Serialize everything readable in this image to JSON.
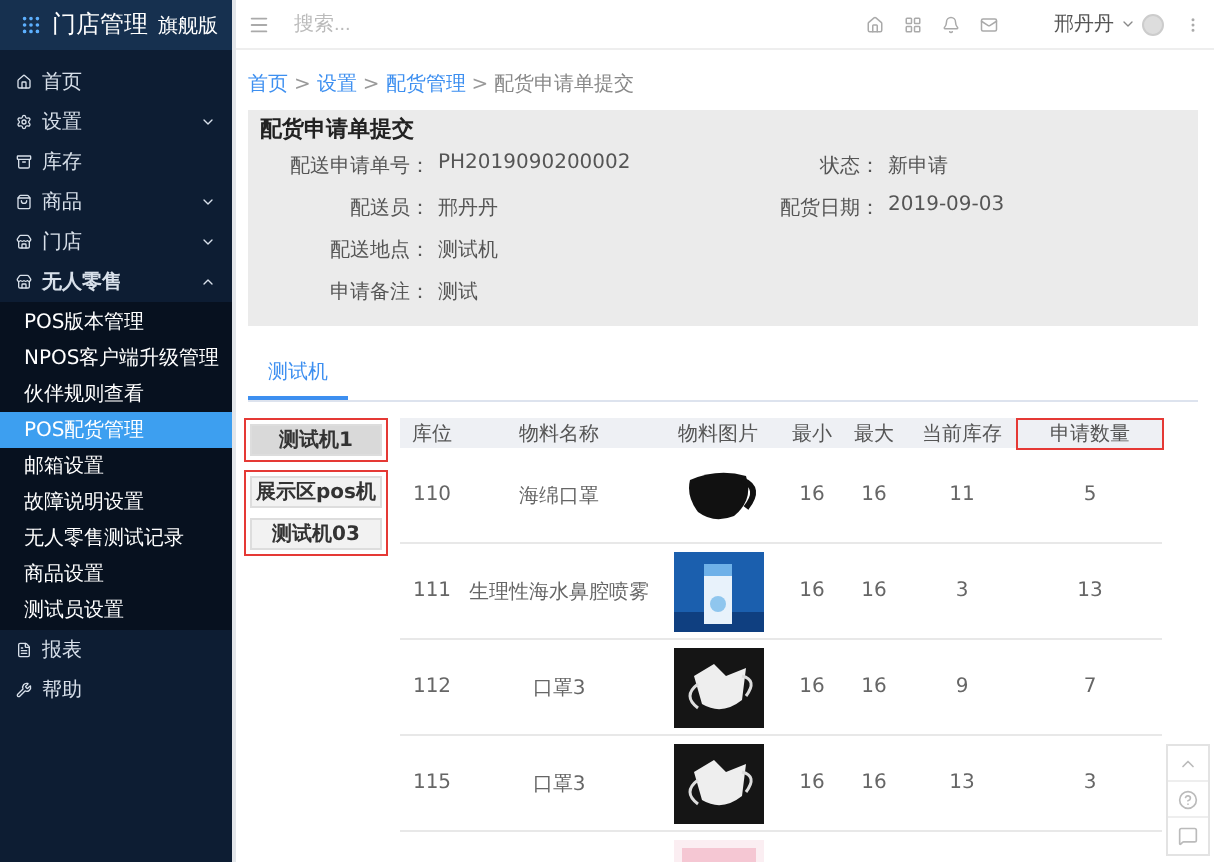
{
  "sidebar": {
    "logo": "门店管理",
    "edition": "旗舰版",
    "items": [
      {
        "label": "首页"
      },
      {
        "label": "设置",
        "expanded": false
      },
      {
        "label": "库存"
      },
      {
        "label": "商品",
        "expanded": false
      },
      {
        "label": "门店",
        "expanded": false
      },
      {
        "label": "无人零售",
        "expanded": true,
        "children": [
          {
            "label": "POS版本管理",
            "selected": false
          },
          {
            "label": "NPOS客户端升级管理",
            "selected": false
          },
          {
            "label": "伙伴规则查看",
            "selected": false
          },
          {
            "label": "POS配货管理",
            "selected": true
          },
          {
            "label": "邮箱设置",
            "selected": false
          },
          {
            "label": "故障说明设置",
            "selected": false
          },
          {
            "label": "无人零售测试记录",
            "selected": false
          },
          {
            "label": "商品设置",
            "selected": false
          },
          {
            "label": "测试员设置",
            "selected": false
          }
        ]
      },
      {
        "label": "报表"
      },
      {
        "label": "帮助"
      }
    ]
  },
  "header": {
    "search": {
      "placeholder": "搜索..."
    },
    "user": "邢丹丹"
  },
  "breadcrumb": [
    {
      "label": "首页",
      "link": true
    },
    {
      "separator": ">"
    },
    {
      "label": "设置",
      "link": true
    },
    {
      "separator": ">"
    },
    {
      "label": "配货管理",
      "link": true
    },
    {
      "separator": ">"
    },
    {
      "label": "配货申请单提交",
      "link": false
    }
  ],
  "page_title": "配货申请单提交",
  "info_rows": [
    [
      {
        "label": "配送申请单号：",
        "value": "PH2019090200002"
      },
      {
        "label": "状态：",
        "value": "新申请"
      }
    ],
    [
      {
        "label": "配送员：",
        "value": "邢丹丹"
      },
      {
        "label": "配货日期：",
        "value": "2019-09-03"
      }
    ],
    [
      {
        "label": "配送地点：",
        "value": "测试机"
      }
    ],
    [
      {
        "label": "申请备注：",
        "value": "测试"
      }
    ]
  ],
  "tabs": [
    {
      "label": "测试机",
      "selected": true
    }
  ],
  "machine_groups": [
    {
      "highlighted": true,
      "machines": [
        {
          "label": "测试机1",
          "selected": true
        }
      ]
    },
    {
      "highlighted": true,
      "machines": [
        {
          "label": "展示区pos机",
          "selected": false
        },
        {
          "label": "测试机03",
          "selected": false
        }
      ]
    }
  ],
  "table": {
    "columns": [
      {
        "label": "库位",
        "highlighted": false
      },
      {
        "label": "物料名称",
        "highlighted": false
      },
      {
        "label": "物料图片",
        "highlighted": false
      },
      {
        "label": "最小",
        "highlighted": false
      },
      {
        "label": "最大",
        "highlighted": false
      },
      {
        "label": "当前库存",
        "highlighted": false
      },
      {
        "label": "申请数量",
        "highlighted": true
      }
    ],
    "rows": [
      {
        "cells": [
          "110",
          "海绵口罩",
          {
            "kind": "picture"
          },
          "16",
          "16",
          "11",
          "5"
        ]
      },
      {
        "cells": [
          "111",
          "生理性海水鼻腔喷雾",
          {
            "kind": "picture"
          },
          "16",
          "16",
          "3",
          "13"
        ]
      },
      {
        "cells": [
          "112",
          "口罩3",
          {
            "kind": "picture"
          },
          "16",
          "16",
          "9",
          "7"
        ]
      },
      {
        "cells": [
          "115",
          "口罩3",
          {
            "kind": "picture"
          },
          "16",
          "16",
          "13",
          "3"
        ]
      },
      {
        "cells": [
          null,
          null,
          {
            "kind": "picture"
          },
          null,
          null,
          null,
          null
        ]
      }
    ]
  }
}
